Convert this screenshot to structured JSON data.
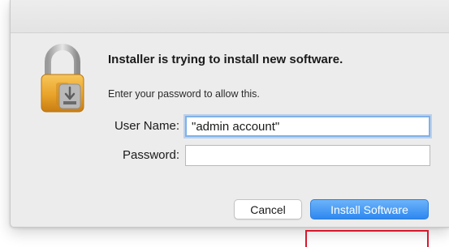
{
  "dialog": {
    "headline": "Installer is trying to install new software.",
    "subtext": "Enter your password to allow this.",
    "icon": "lock-icon"
  },
  "form": {
    "username_label": "User Name:",
    "username_value": "\"admin account\"",
    "password_label": "Password:",
    "password_value": ""
  },
  "buttons": {
    "cancel_label": "Cancel",
    "install_label": "Install Software"
  },
  "colors": {
    "accent": "#2e88f0",
    "focus_ring": "#7fb1ea",
    "highlight": "#d9182d",
    "dialog_bg": "#ececec"
  }
}
